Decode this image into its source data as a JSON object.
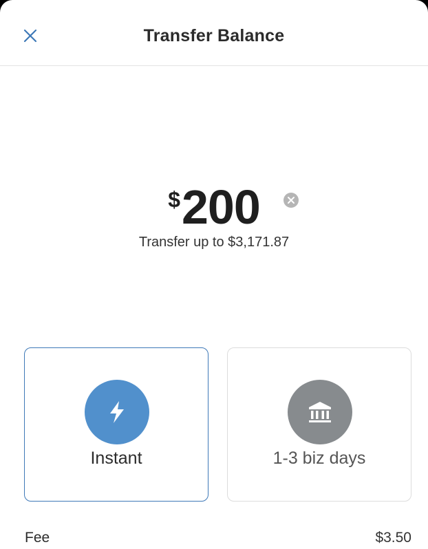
{
  "header": {
    "title": "Transfer Balance"
  },
  "amount": {
    "currency_symbol": "$",
    "value": "200",
    "limit_text": "Transfer up to $3,171.87"
  },
  "options": [
    {
      "label": "Instant",
      "icon": "lightning-bolt-icon",
      "selected": true
    },
    {
      "label": "1-3 biz days",
      "icon": "bank-icon",
      "selected": false
    }
  ],
  "fee": {
    "label": "Fee",
    "value": "$3.50"
  },
  "colors": {
    "accent": "#3d78b7",
    "instant_circle": "#5190cc",
    "standard_circle": "#878b8e"
  }
}
